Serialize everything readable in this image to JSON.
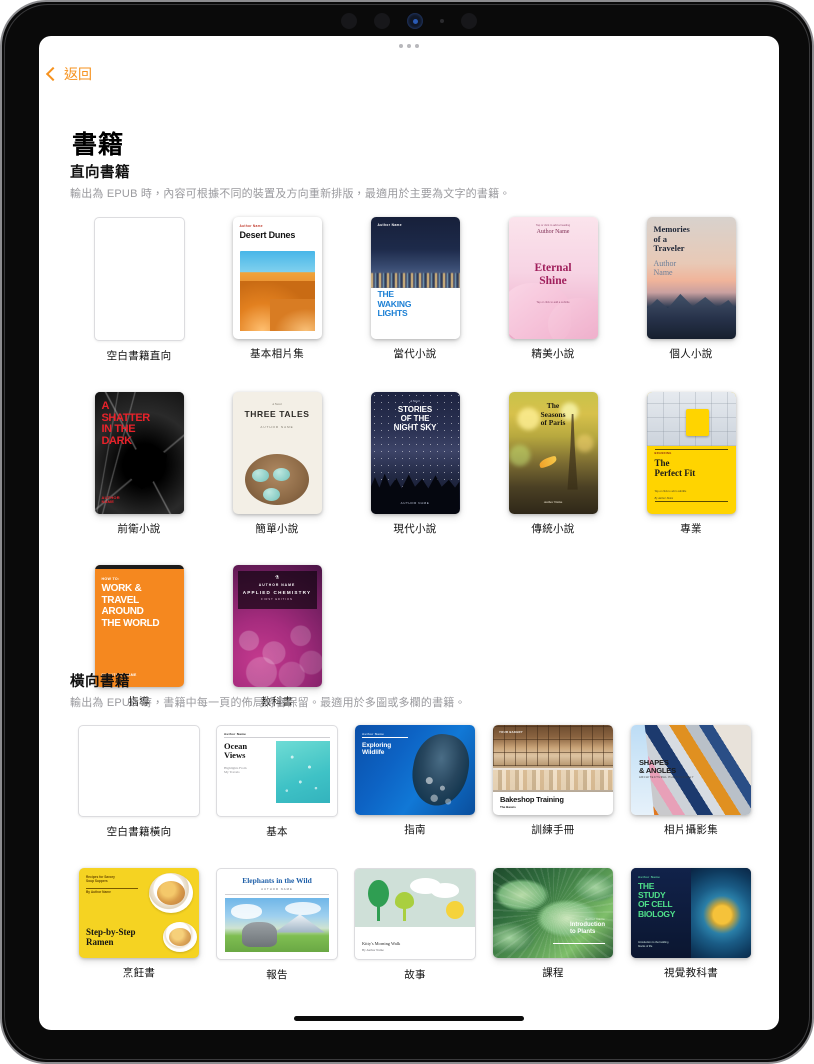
{
  "nav": {
    "back_label": "返回",
    "back_icon": "chevron-left-icon"
  },
  "page": {
    "title": "書籍"
  },
  "sections": [
    {
      "id": "portrait",
      "title": "直向書籍",
      "subtitle": "輸出為 EPUB 時，內容可根據不同的裝置及方向重新排版，最適用於主要為文字的書籍。",
      "items": [
        {
          "label": "空白書籍直向",
          "art": "blank",
          "cover": {}
        },
        {
          "label": "基本相片集",
          "art": "desert",
          "cover": {
            "author": "Author Name",
            "title": "Desert Dunes"
          }
        },
        {
          "label": "當代小說",
          "art": "waking",
          "cover": {
            "author": "Author Name",
            "title": "THE WAKING LIGHTS"
          }
        },
        {
          "label": "精美小說",
          "art": "eternal",
          "cover": {
            "tap": "Tap or click to add a heading",
            "author": "Author Name",
            "title": "Eternal Shine",
            "subtitle": "Tap or click to add a subtitle"
          }
        },
        {
          "label": "個人小說",
          "art": "memories",
          "cover": {
            "title": "Memories of a Traveler",
            "author": "Author Name"
          }
        },
        {
          "label": "前衛小說",
          "art": "shatter",
          "cover": {
            "title": "A SHATTER IN THE DARK",
            "author": "AUTHOR NAME"
          }
        },
        {
          "label": "簡單小說",
          "art": "three",
          "cover": {
            "kicker": "A Novel",
            "title": "THREE TALES",
            "author": "AUTHOR NAME"
          }
        },
        {
          "label": "現代小說",
          "art": "stories",
          "cover": {
            "kicker": "A Novel",
            "title": "STORIES OF THE NIGHT SKY",
            "author": "AUTHOR NAME"
          }
        },
        {
          "label": "傳統小說",
          "art": "paris",
          "cover": {
            "title": "The Seasons of Paris",
            "author": "Author Name"
          }
        },
        {
          "label": "專業",
          "art": "perfect",
          "cover": {
            "kicker": "BRANDING",
            "title": "The Perfect Fit",
            "subtitle": "Tap or click to add a subtitle",
            "author": "By Author Name"
          }
        },
        {
          "label": "指導",
          "art": "work",
          "cover": {
            "kicker": "HOW TO:",
            "title": "WORK & TRAVEL AROUND THE WORLD",
            "author": "BY AUTHOR NAME"
          }
        },
        {
          "label": "教科書",
          "art": "chem",
          "cover": {
            "icon": "⚗",
            "author": "AUTHOR NAME",
            "title": "APPLIED CHEMISTRY",
            "edition": "FIRST EDITION"
          }
        }
      ]
    },
    {
      "id": "landscape",
      "title": "橫向書籍",
      "subtitle": "輸出為 EPUB 時，書籍中每一頁的佈局將會保留。最適用於多圖或多欄的書籍。",
      "items": [
        {
          "label": "空白書籍橫向",
          "art": "blank-l",
          "cover": {}
        },
        {
          "label": "基本",
          "art": "ocean",
          "cover": {
            "author": "Author Name",
            "title": "Ocean Views",
            "subtitle": "Highlights From My Travels"
          }
        },
        {
          "label": "指南",
          "art": "wild",
          "cover": {
            "author": "Author Name",
            "title": "Exploring Wildlife"
          }
        },
        {
          "label": "訓練手冊",
          "art": "bake",
          "cover": {
            "author": "YOUR BAKERY",
            "title": "Bakeshop Training",
            "subtitle": "The Basics"
          }
        },
        {
          "label": "相片攝影集",
          "art": "shapes",
          "cover": {
            "title": "SHAPES & ANGLES",
            "subtitle": "ARCHITECTURAL PHOTOGRAPHY"
          }
        },
        {
          "label": "烹飪書",
          "art": "ramen",
          "cover": {
            "kicker": "Recipes for Savory Soup Suppers",
            "author": "By Author Name",
            "title": "Step-by-Step Ramen"
          }
        },
        {
          "label": "報告",
          "art": "eleph",
          "cover": {
            "title": "Elephants in the Wild",
            "author": "AUTHOR NAME"
          }
        },
        {
          "label": "故事",
          "art": "kitty",
          "cover": {
            "title": "Kitty's Morning Walk",
            "author": "By Author Name"
          }
        },
        {
          "label": "課程",
          "art": "plants",
          "cover": {
            "author": "Author Name",
            "title": "Introduction to Plants"
          }
        },
        {
          "label": "視覺教科書",
          "art": "cell",
          "cover": {
            "author": "Author Name",
            "title": "THE STUDY OF CELL BIOLOGY",
            "subtitle": "Introduction to the building blocks of life"
          }
        }
      ]
    }
  ],
  "colors": {
    "accent": "#f6921e",
    "text": "#111111",
    "muted": "#9a9a9e",
    "background": "#ffffff"
  },
  "device": {
    "home_indicator": "home-indicator",
    "grabber": "window-grabber"
  }
}
